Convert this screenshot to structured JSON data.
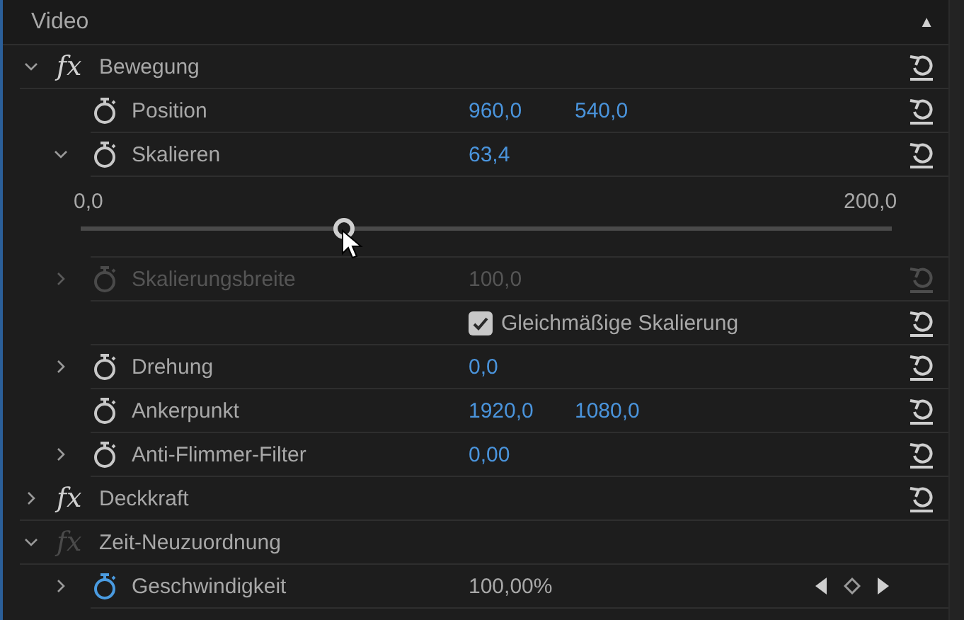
{
  "section": {
    "title": "Video",
    "collapse_glyph": "▲"
  },
  "rows": [
    {
      "kind": "effect",
      "badge": "fx",
      "name": "Bewegung",
      "expanded": true,
      "fx_enabled": true,
      "reset": true
    },
    {
      "kind": "param",
      "name": "Position",
      "values": [
        "960,0",
        "540,0"
      ],
      "animated": false,
      "reset": true,
      "disabled": false
    },
    {
      "kind": "param",
      "name": "Skalieren",
      "values": [
        "63,4"
      ],
      "expanded": true,
      "animated": false,
      "reset": true,
      "disabled": false
    },
    {
      "kind": "slider",
      "min": "0,0",
      "max": "200,0",
      "level": 0.317
    },
    {
      "kind": "param",
      "name": "Skalierungsbreite",
      "values": [
        "100,0"
      ],
      "expanded": false,
      "animated": false,
      "reset": true,
      "disabled": true
    },
    {
      "kind": "checkbox",
      "label": "Gleichmäßige Skalierung",
      "checked": true,
      "reset": true,
      "disabled": false
    },
    {
      "kind": "param",
      "name": "Drehung",
      "values": [
        "0,0"
      ],
      "expanded": false,
      "animated": false,
      "reset": true,
      "disabled": false
    },
    {
      "kind": "param",
      "name": "Ankerpunkt",
      "values": [
        "1920,0",
        "1080,0"
      ],
      "animated": false,
      "reset": true,
      "disabled": false
    },
    {
      "kind": "param",
      "name": "Anti-Flimmer-Filter",
      "values": [
        "0,00"
      ],
      "expanded": false,
      "animated": false,
      "reset": true,
      "disabled": false
    },
    {
      "kind": "effect",
      "badge": "fx",
      "name": "Deckkraft",
      "expanded": false,
      "fx_enabled": true,
      "reset": true
    },
    {
      "kind": "effect",
      "badge": "fx",
      "name": "Zeit-Neuzuordnung",
      "expanded": true,
      "fx_enabled": false,
      "reset": false
    },
    {
      "kind": "param",
      "name": "Geschwindigkeit",
      "values": [
        "100,00%"
      ],
      "expanded": false,
      "animated": true,
      "reset": false,
      "keyframe_nav": true,
      "disabled": false,
      "plain_value": true
    }
  ]
}
